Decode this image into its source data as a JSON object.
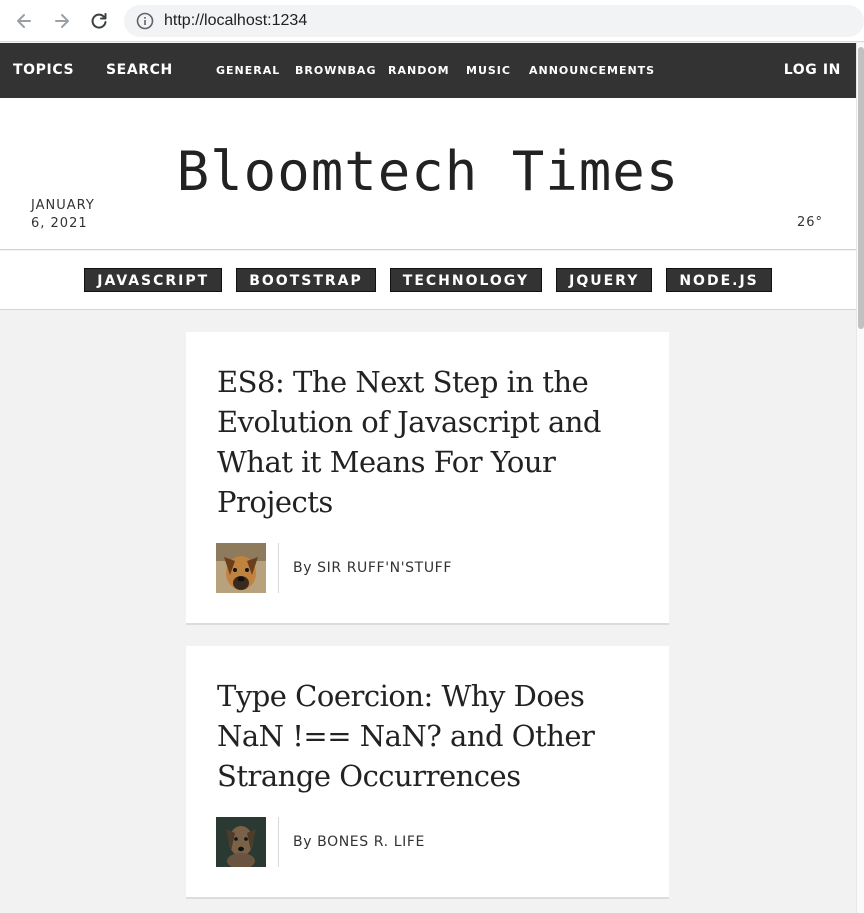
{
  "browser": {
    "url": "http://localhost:1234"
  },
  "topbar": {
    "topics": "TOPICS",
    "search": "SEARCH",
    "nav": [
      "GENERAL",
      "BROWNBAG",
      "RANDOM",
      "MUSIC",
      "ANNOUNCEMENTS"
    ],
    "login": "LOG IN"
  },
  "header": {
    "date_line1": "JANUARY",
    "date_line2": "6, 2021",
    "title": "Bloomtech Times",
    "temp": "26°"
  },
  "tabs": [
    "JAVASCRIPT",
    "BOOTSTRAP",
    "TECHNOLOGY",
    "JQUERY",
    "NODE.JS"
  ],
  "articles": [
    {
      "title": "ES8: The Next Step in the Evolution of Javascript and What it Means For Your Projects",
      "author": "By SIR RUFF'N'STUFF"
    },
    {
      "title": "Type Coercion: Why Does NaN !== NaN? and Other Strange Occurrences",
      "author": "By BONES R. LIFE"
    }
  ],
  "colors": {
    "topbar": "#333333",
    "background": "#f2f2f2",
    "card": "#ffffff"
  }
}
